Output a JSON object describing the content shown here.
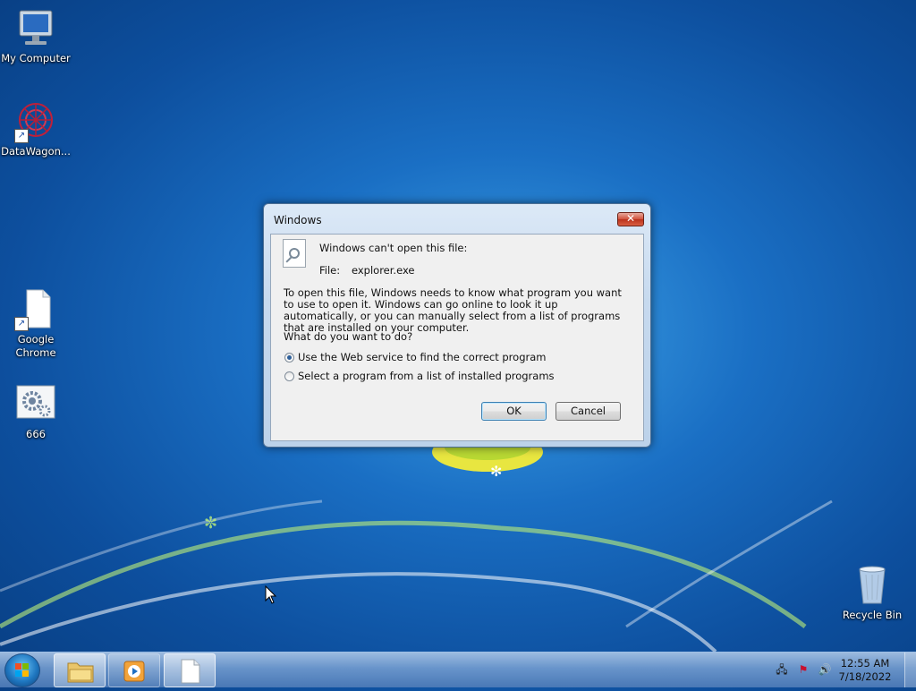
{
  "desktop": {
    "icons": [
      {
        "label": "My Computer",
        "icon": "computer-icon"
      },
      {
        "label": "DataWagon...",
        "icon": "datawagon-icon"
      },
      {
        "label": "Google Chrome",
        "icon": "chrome-shortcut-icon"
      },
      {
        "label": "666",
        "icon": "settings-gear-icon"
      },
      {
        "label": "Recycle Bin",
        "icon": "recycle-bin-icon"
      }
    ]
  },
  "dialog": {
    "title": "Windows",
    "close_glyph": "✕",
    "heading": "Windows can't open this file:",
    "file_label": "File:",
    "file_name": "explorer.exe",
    "description": "To open this file, Windows needs to know what program you want to use to open it. Windows can go online to look it up automatically, or you can manually select from a list of programs that are installed on your computer.",
    "question": "What do you want to do?",
    "options": [
      {
        "label": "Use the Web service to find the correct program",
        "selected": true
      },
      {
        "label": "Select a program from a list of installed programs",
        "selected": false
      }
    ],
    "ok_label": "OK",
    "cancel_label": "Cancel"
  },
  "taskbar": {
    "pinned": [
      {
        "name": "windows-explorer",
        "icon": "folder-icon",
        "active": true
      },
      {
        "name": "media-player",
        "icon": "media-player-icon",
        "active": false
      },
      {
        "name": "blank-document",
        "icon": "document-icon",
        "active": true
      }
    ],
    "tray_icons": [
      "network-icon",
      "action-center-flag-icon",
      "volume-icon"
    ],
    "clock": {
      "time": "12:55 AM",
      "date": "7/18/2022"
    }
  },
  "colors": {
    "accent": "#1a6fc4",
    "close_button": "#c7412a"
  }
}
